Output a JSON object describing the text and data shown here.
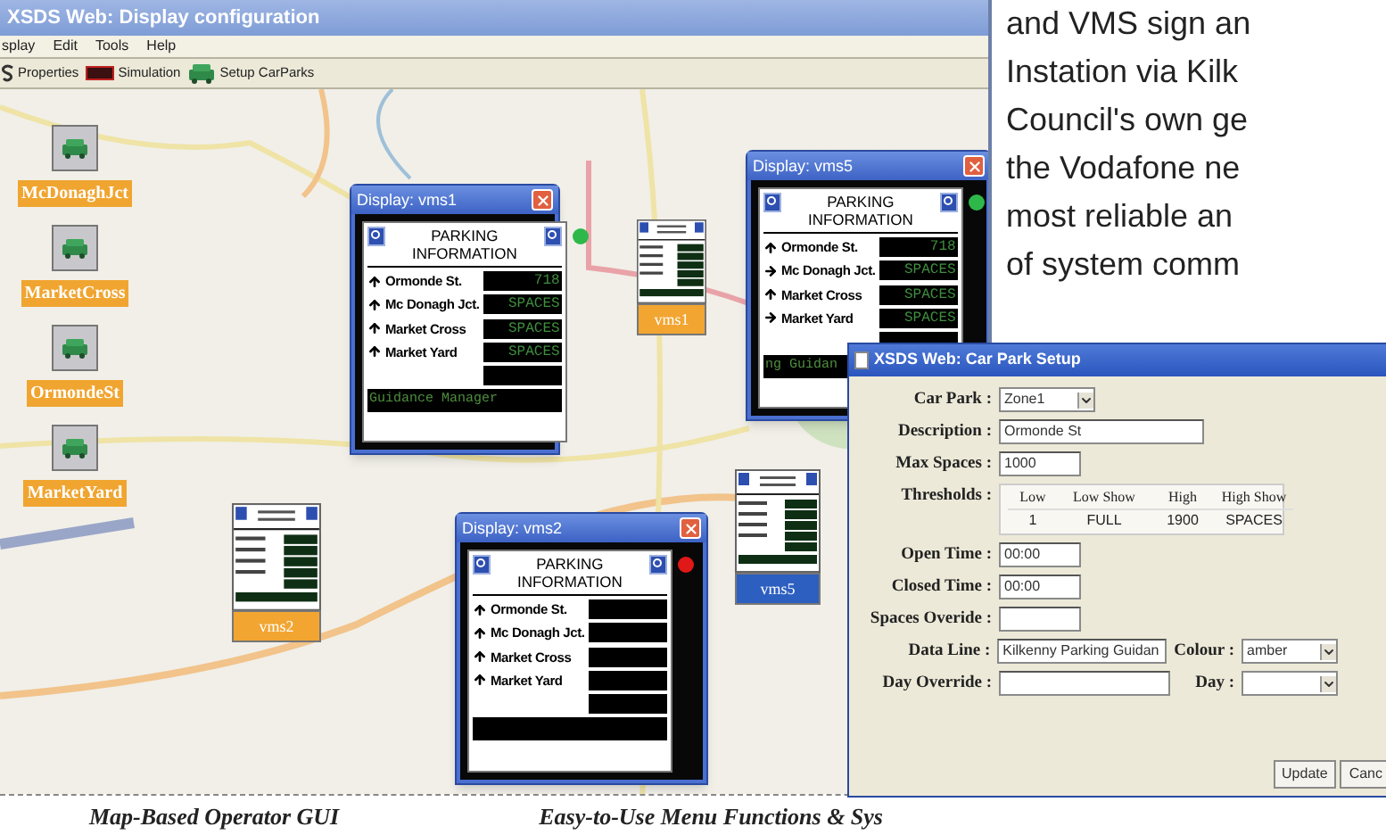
{
  "window": {
    "title": "XSDS Web: Display configuration"
  },
  "menu": [
    "splay",
    "Edit",
    "Tools",
    "Help"
  ],
  "toolbar": [
    "Properties",
    "Simulation",
    "Setup CarParks"
  ],
  "car_parks": [
    "McDonaghJct",
    "MarketCross",
    "OrmondeSt",
    "MarketYard"
  ],
  "mini_signs": [
    {
      "label": "vms1",
      "color": "#f2a531"
    },
    {
      "label": "vms2",
      "color": "#f2a531"
    },
    {
      "label": "vms5",
      "color": "#2d5fc0"
    }
  ],
  "displays": [
    {
      "title": "Display: vms1",
      "heading": [
        "PARKING",
        "INFORMATION"
      ],
      "color": "#2fb84a",
      "data_line": "Guidance Manager",
      "rows": [
        {
          "name": "Ormonde St.",
          "kind": "up",
          "value": "718"
        },
        {
          "name": "Mc Donagh Jct.",
          "kind": "up",
          "value": "SPACES"
        },
        {
          "name": "Market Cross",
          "kind": "up",
          "value": "SPACES"
        },
        {
          "name": "Market Yard",
          "kind": "up",
          "value": "SPACES"
        }
      ]
    },
    {
      "title": "Display: vms5",
      "heading": [
        "PARKING",
        "INFORMATION"
      ],
      "color": "#2fb84a",
      "data_line": "ng Guidan",
      "rows": [
        {
          "name": "Ormonde St.",
          "kind": "up",
          "value": "718"
        },
        {
          "name": "Mc Donagh Jct.",
          "kind": "right",
          "value": "SPACES"
        },
        {
          "name": "Market Cross",
          "kind": "up",
          "value": "SPACES"
        },
        {
          "name": "Market Yard",
          "kind": "right",
          "value": "SPACES"
        }
      ]
    },
    {
      "title": "Display: vms2",
      "heading": [
        "PARKING",
        "INFORMATION"
      ],
      "color": "#e01818",
      "rows": [
        {
          "name": "Ormonde St.",
          "kind": "up"
        },
        {
          "name": "Mc Donagh Jct.",
          "kind": "up"
        },
        {
          "name": "Market Cross",
          "kind": "up"
        },
        {
          "name": "Market Yard",
          "kind": "up"
        }
      ]
    }
  ],
  "setup_dialog": {
    "title": "XSDS Web: Car Park Setup",
    "fields": [
      {
        "label": "Car Park :",
        "kind": "select",
        "value": "Zone1"
      },
      {
        "label": "Description :",
        "kind": "text",
        "value": "Ormonde St"
      },
      {
        "label": "Max Spaces :",
        "kind": "text",
        "value": "1000"
      },
      {
        "label": "Thresholds :",
        "kind": "table",
        "columns": [
          "Low",
          "Low Show",
          "High",
          "High Show"
        ],
        "row": [
          "1",
          "FULL",
          "1900",
          "SPACES"
        ]
      },
      {
        "label": "Open Time :",
        "kind": "text",
        "value": "00:00"
      },
      {
        "label": "Closed Time :",
        "kind": "text",
        "value": "00:00"
      },
      {
        "label": "Spaces Overide :",
        "kind": "text"
      },
      {
        "label": "Data Line :",
        "kind": "text",
        "value": "Kilkenny Parking Guidan",
        "extra": {
          "label": "Colour :",
          "kind": "select",
          "value": "amber"
        }
      },
      {
        "label": "Day Override :",
        "kind": "text",
        "extra": {
          "label": "Day :",
          "kind": "select"
        }
      }
    ],
    "buttons": [
      "Update",
      "Canc"
    ]
  },
  "captions": [
    "Map-Based Operator GUI",
    "Easy-to-Use Menu Functions & Sys"
  ],
  "article_lines": [
    "and VMS sign an",
    "Instation via Kilk",
    "Council's own ge",
    "the Vodafone ne",
    "most reliable an",
    "of system comm"
  ]
}
